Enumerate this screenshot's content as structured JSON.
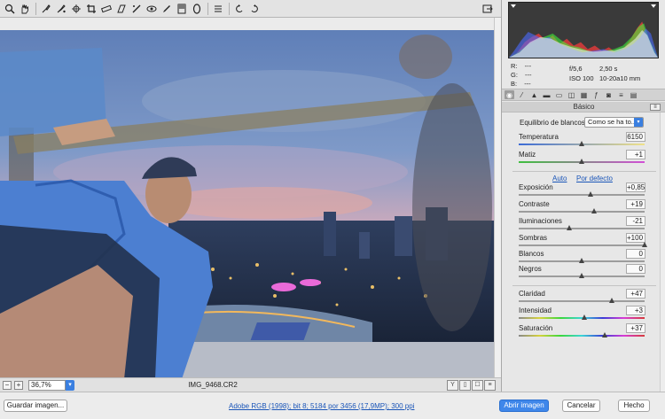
{
  "toolbar": {
    "tools": [
      {
        "name": "zoom-tool-icon",
        "selected": false
      },
      {
        "name": "hand-tool-icon",
        "selected": false
      },
      {
        "name": "white-balance-tool-icon",
        "selected": false
      },
      {
        "name": "color-sampler-icon",
        "selected": false
      },
      {
        "name": "targeted-adjustment-icon",
        "selected": false
      },
      {
        "name": "crop-tool-icon",
        "selected": false
      },
      {
        "name": "straighten-tool-icon",
        "selected": false
      },
      {
        "name": "transform-tool-icon",
        "selected": false
      },
      {
        "name": "spot-removal-icon",
        "selected": false
      },
      {
        "name": "red-eye-icon",
        "selected": false
      },
      {
        "name": "adjustment-brush-icon",
        "selected": false
      },
      {
        "name": "graduated-filter-icon",
        "selected": false
      },
      {
        "name": "radial-filter-icon",
        "selected": false
      },
      {
        "name": "preferences-icon",
        "selected": false
      },
      {
        "name": "rotate-left-icon",
        "selected": false
      },
      {
        "name": "rotate-right-icon",
        "selected": false
      }
    ]
  },
  "status": {
    "zoom_minus": "−",
    "zoom_plus": "+",
    "zoom_value": "36,7%",
    "filename": "IMG_9468.CR2"
  },
  "info": {
    "r_label": "R:",
    "g_label": "G:",
    "b_label": "B:",
    "r_value": "---",
    "g_value": "---",
    "b_value": "---",
    "aperture": "f/5,6",
    "shutter": "2,50 s",
    "iso": "ISO 100",
    "focal": "10-20a10 mm"
  },
  "panel": {
    "section_title": "Básico",
    "wb_label": "Equilibrio de blancos:",
    "wb_value": "Como se ha to...",
    "auto_label": "Auto",
    "default_label": "Por defecto",
    "adjustments": [
      {
        "label": "Temperatura",
        "value": "6150",
        "pos": 0.5
      },
      {
        "label": "Matiz",
        "value": "+1",
        "pos": 0.5
      },
      {
        "label": "Exposición",
        "value": "+0,85",
        "pos": 0.57
      },
      {
        "label": "Contraste",
        "value": "+19",
        "pos": 0.6
      },
      {
        "label": "Iluminaciones",
        "value": "-21",
        "pos": 0.4
      },
      {
        "label": "Sombras",
        "value": "+100",
        "pos": 1.0
      },
      {
        "label": "Blancos",
        "value": "0",
        "pos": 0.5
      },
      {
        "label": "Negros",
        "value": "0",
        "pos": 0.5
      },
      {
        "label": "Claridad",
        "value": "+47",
        "pos": 0.74
      },
      {
        "label": "Intensidad",
        "value": "+3",
        "pos": 0.52
      },
      {
        "label": "Saturación",
        "value": "+37",
        "pos": 0.68
      }
    ]
  },
  "footer": {
    "save_label": "Guardar imagen...",
    "workflow_label": "Adobe RGB (1998); bit 8; 5184 por 3456 (17,9MP); 300 ppi",
    "open_label": "Abrir imagen",
    "cancel_label": "Cancelar",
    "done_label": "Hecho"
  },
  "colors": {
    "accent": "#3f87ea",
    "link": "#1a55b8"
  }
}
